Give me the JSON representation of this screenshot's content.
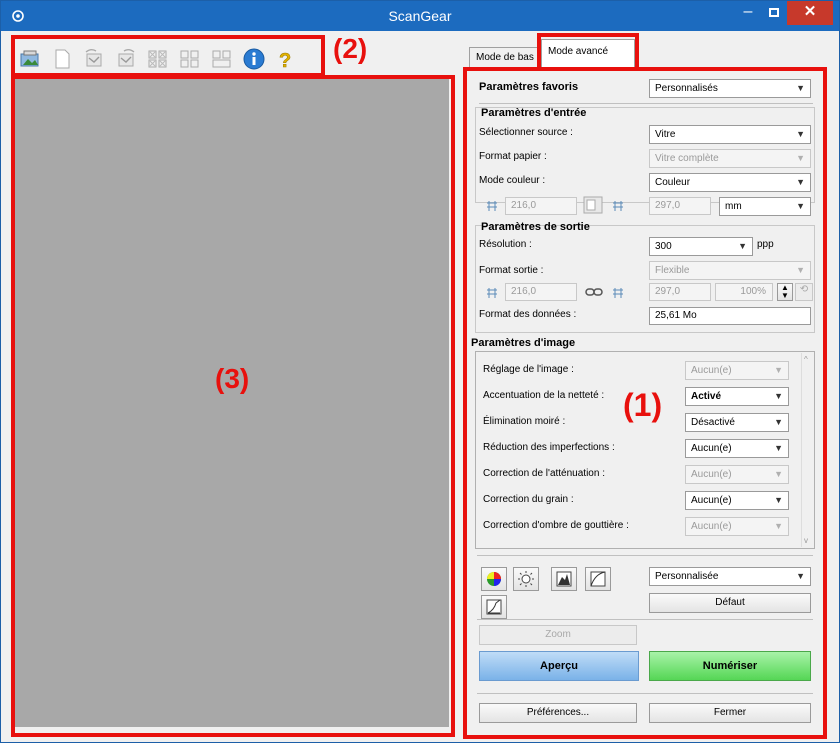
{
  "window": {
    "title": "ScanGear"
  },
  "callouts": {
    "c1": "(1)",
    "c2": "(2)",
    "c3": "(3)"
  },
  "tabs": {
    "basic": "Mode de bas",
    "advanced": "Mode avancé"
  },
  "favorites": {
    "label": "Paramètres favoris",
    "value": "Personnalisés"
  },
  "input": {
    "heading": "Paramètres d'entrée",
    "source_label": "Sélectionner source :",
    "source_value": "Vitre",
    "paper_label": "Format papier :",
    "paper_value": "Vitre complète",
    "color_label": "Mode couleur :",
    "color_value": "Couleur",
    "width": "216,0",
    "height": "297,0",
    "unit": "mm"
  },
  "output": {
    "heading": "Paramètres de sortie",
    "resolution_label": "Résolution :",
    "resolution_value": "300",
    "resolution_unit": "ppp",
    "format_label": "Format sortie :",
    "format_value": "Flexible",
    "width": "216,0",
    "height": "297,0",
    "scale": "100%",
    "data_size_label": "Format des données :",
    "data_size_value": "25,61 Mo"
  },
  "image": {
    "heading": "Paramètres d'image",
    "rows": [
      {
        "label": "Réglage de l'image :",
        "value": "Aucun(e)",
        "enabled": false,
        "bold": false
      },
      {
        "label": "Accentuation de la netteté :",
        "value": "Activé",
        "enabled": true,
        "bold": true
      },
      {
        "label": "Élimination moiré :",
        "value": "Désactivé",
        "enabled": true,
        "bold": false
      },
      {
        "label": "Réduction des imperfections :",
        "value": "Aucun(e)",
        "enabled": true,
        "bold": false
      },
      {
        "label": "Correction de l'atténuation :",
        "value": "Aucun(e)",
        "enabled": false,
        "bold": false
      },
      {
        "label": "Correction du grain :",
        "value": "Aucun(e)",
        "enabled": true,
        "bold": false
      },
      {
        "label": "Correction d'ombre de gouttière :",
        "value": "Aucun(e)",
        "enabled": false,
        "bold": false
      }
    ]
  },
  "tone": {
    "preset_value": "Personnalisée",
    "default_label": "Défaut"
  },
  "actions": {
    "zoom": "Zoom",
    "preview": "Aperçu",
    "scan": "Numériser",
    "preferences": "Préférences...",
    "close": "Fermer"
  },
  "colors": {
    "titlebar": "#1c6bbf",
    "callout_red": "#e8100d",
    "preview_bg": "#a8a8a8"
  }
}
